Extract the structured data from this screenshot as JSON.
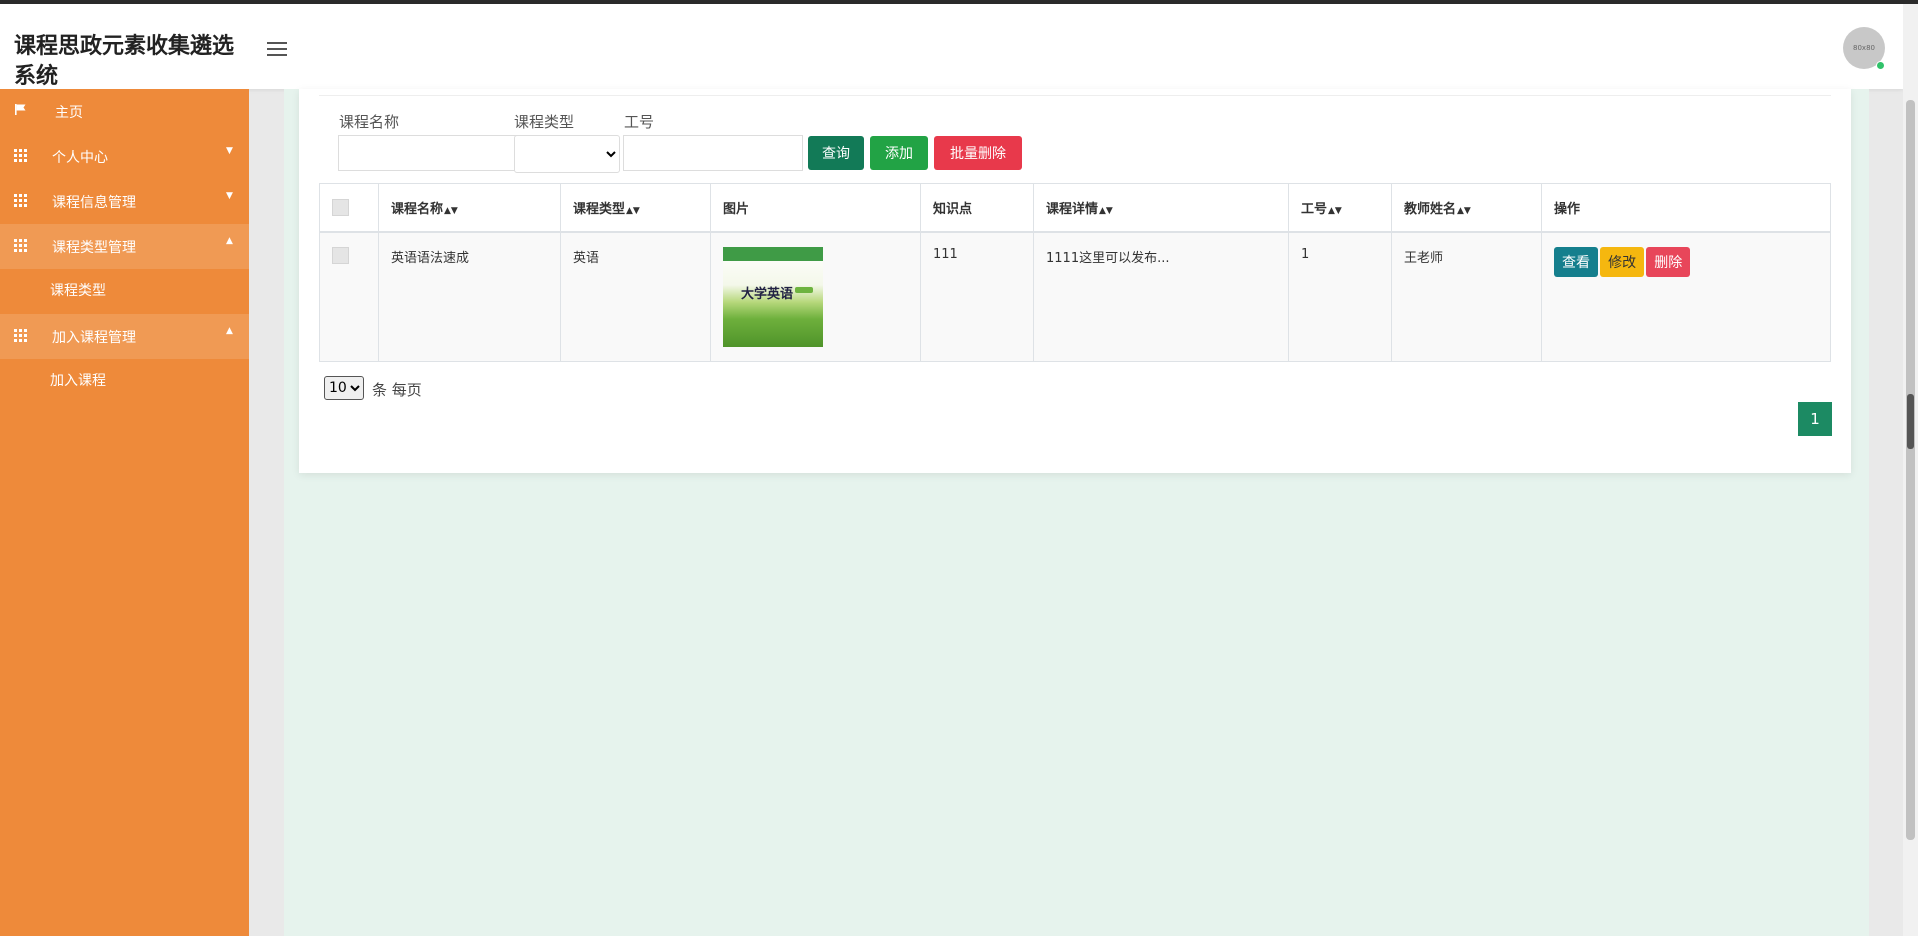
{
  "app": {
    "title": "课程思政元素收集遴选系统",
    "avatar_text": "80x80"
  },
  "sidebar": {
    "items": [
      {
        "label": "主页",
        "icon": "flag-icon",
        "expanded": false
      },
      {
        "label": "个人中心",
        "icon": "grid-icon",
        "expanded": false
      },
      {
        "label": "课程信息管理",
        "icon": "grid-icon",
        "expanded": false
      },
      {
        "label": "课程类型管理",
        "icon": "grid-icon",
        "expanded": true,
        "children": [
          "课程类型"
        ]
      },
      {
        "label": "加入课程管理",
        "icon": "grid-icon",
        "expanded": true,
        "children": [
          "加入课程"
        ]
      }
    ]
  },
  "search": {
    "course_name_label": "课程名称",
    "course_type_label": "课程类型",
    "work_no_label": "工号",
    "course_name_value": "",
    "work_no_value": "",
    "course_type_selected": ""
  },
  "toolbar": {
    "query_label": "查询",
    "add_label": "添加",
    "batch_delete_label": "批量删除"
  },
  "table": {
    "columns": [
      "课程名称",
      "课程类型",
      "图片",
      "知识点",
      "课程详情",
      "工号",
      "教师姓名",
      "操作"
    ],
    "rows": [
      {
        "course_name": "英语语法速成",
        "course_type": "英语",
        "image_title": "大学英语",
        "knowledge_point": "111",
        "course_detail": "1111这里可以发布...",
        "work_no": "1",
        "teacher_name": "王老师"
      }
    ],
    "actions": {
      "view": "查看",
      "edit": "修改",
      "delete": "删除"
    }
  },
  "pagination": {
    "page_size": "10",
    "per_page_text": "条 每页",
    "current_page": "1"
  },
  "colors": {
    "sidebar": "#ee8a3a",
    "query_button": "#127a57",
    "add_button": "#22a345",
    "delete_button": "#e8394b",
    "view_button": "#157f8d",
    "edit_button": "#f5b70f",
    "page_button": "#1c8a63"
  }
}
